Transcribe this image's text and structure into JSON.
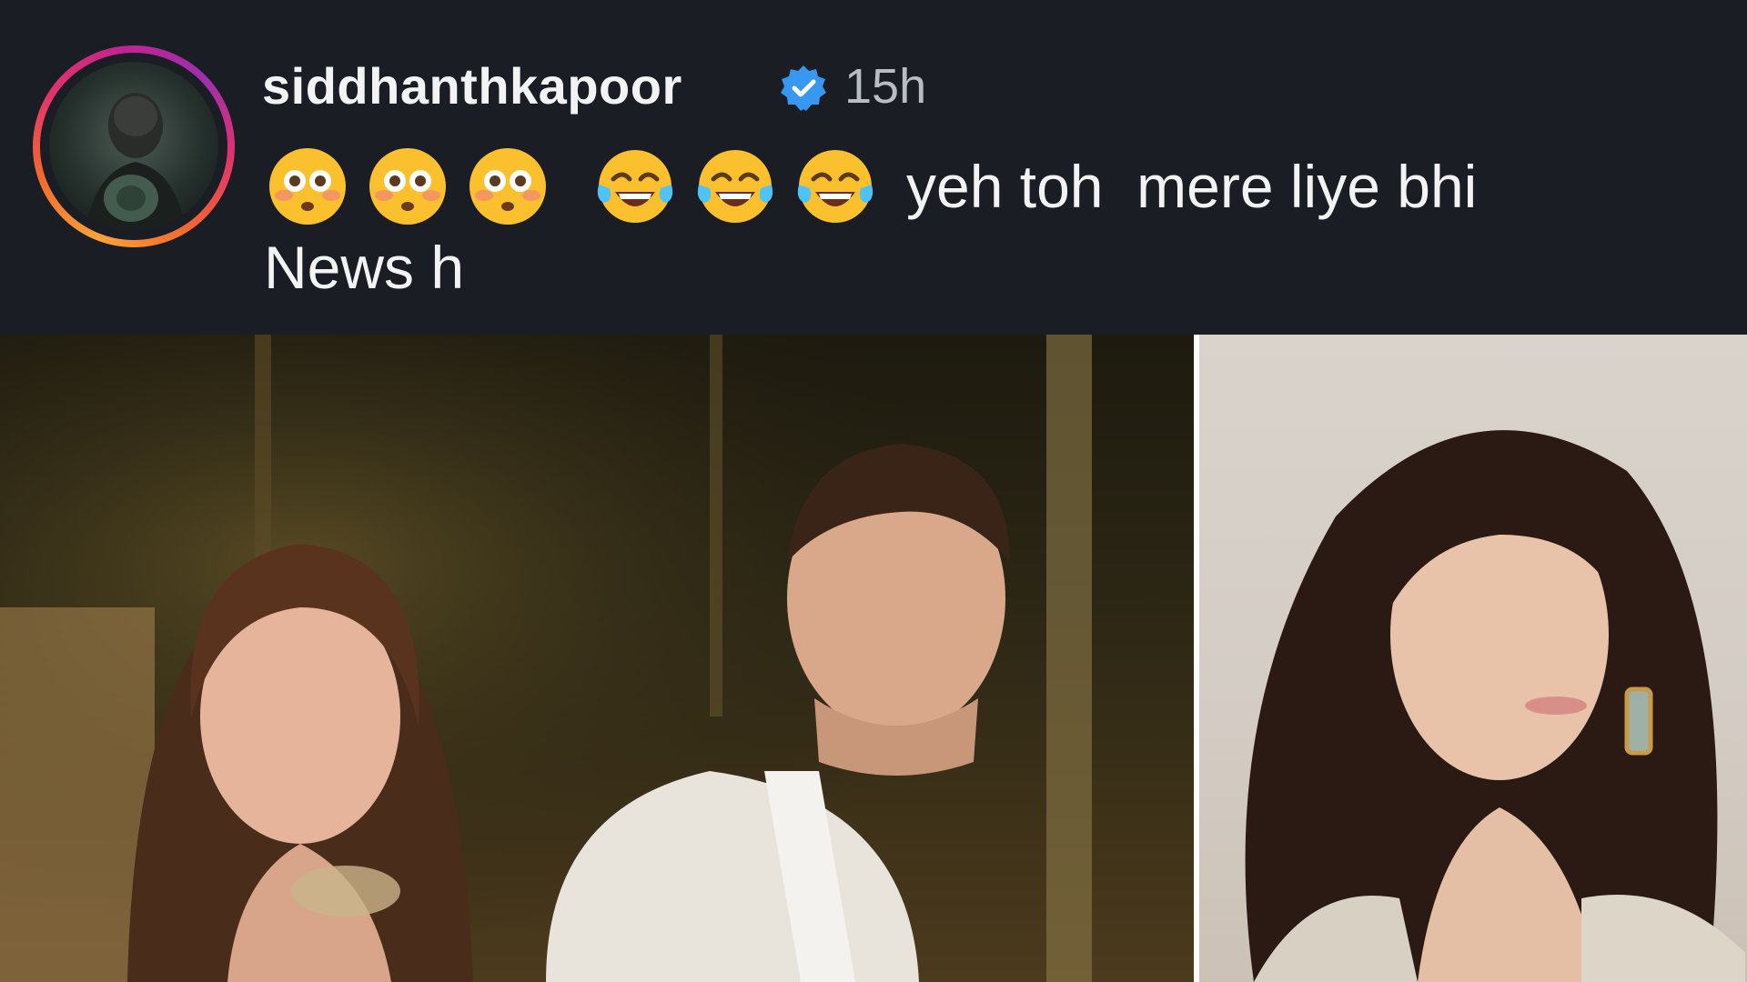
{
  "comment": {
    "username": "siddhanthkapoor",
    "timestamp": "15h",
    "text_line1": "yeh toh  mere liye bhi",
    "text_line2": "News h",
    "emojis": [
      "flushed-face",
      "flushed-face",
      "flushed-face",
      "tears-of-joy",
      "tears-of-joy",
      "tears-of-joy"
    ],
    "verified": true
  },
  "colors": {
    "panel_background": "#1a1d24",
    "text": "#f3f3f3",
    "timestamp": "#b8bcc4",
    "verified_badge": "#3897f0"
  },
  "images": {
    "left_photo": "couple-photo",
    "right_photo": "portrait-photo"
  }
}
